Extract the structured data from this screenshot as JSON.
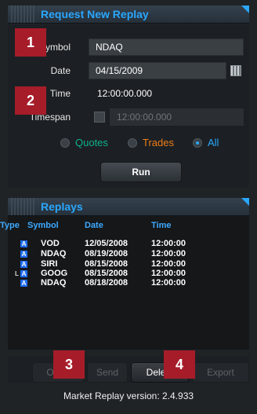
{
  "request_panel": {
    "title": "Request New Replay",
    "symbol_label": "Symbol",
    "symbol_value": "NDAQ",
    "date_label": "Date",
    "date_value": "04/15/2009",
    "time_label": "Time",
    "time_value": "12:00:00.000",
    "timespan_label": "Timespan",
    "timespan_value": "12:00:00.000",
    "radios": [
      {
        "label": "Quotes",
        "color": "#0fb08c",
        "selected": false
      },
      {
        "label": "Trades",
        "color": "#ef7d17",
        "selected": false
      },
      {
        "label": "All",
        "color": "#2aa7ff",
        "selected": true
      }
    ],
    "run_label": "Run"
  },
  "replays_panel": {
    "title": "Replays",
    "columns": [
      "Type",
      "Symbol",
      "Date",
      "Time"
    ],
    "rows": [
      {
        "type": "A",
        "symbol": "VOD",
        "date": "12/05/2008",
        "time": "12:00:00",
        "locked": false
      },
      {
        "type": "A",
        "symbol": "NDAQ",
        "date": "08/19/2008",
        "time": "12:00:00",
        "locked": false
      },
      {
        "type": "A",
        "symbol": "SIRI",
        "date": "08/15/2008",
        "time": "12:00:00",
        "locked": false
      },
      {
        "type": "A",
        "symbol": "GOOG",
        "date": "08/15/2008",
        "time": "12:00:00",
        "locked": true
      },
      {
        "type": "A",
        "symbol": "NDAQ",
        "date": "08/18/2008",
        "time": "12:00:00",
        "locked": false
      }
    ]
  },
  "buttons": {
    "open_label": "Open",
    "send_label": "Send",
    "delete_label": "Delete",
    "export_label": "Export"
  },
  "version_text": "Market Replay version: 2.4.933",
  "callouts": [
    "1",
    "2",
    "3",
    "4"
  ]
}
